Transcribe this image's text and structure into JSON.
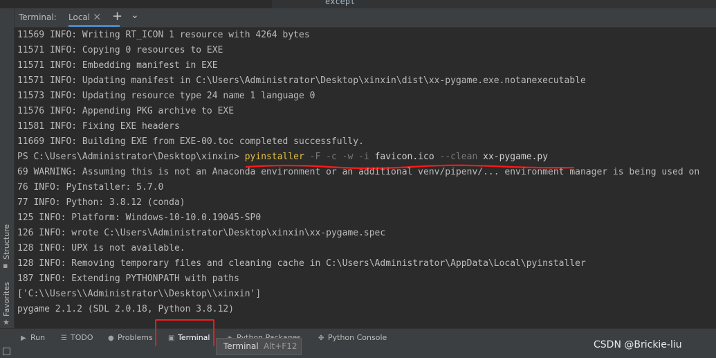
{
  "editor": {
    "fragment": "except"
  },
  "terminal": {
    "header_title": "Terminal:",
    "tab_label": "Local",
    "lines": [
      "11569 INFO: Writing RT_ICON 1 resource with 4264 bytes",
      "11571 INFO: Copying 0 resources to EXE",
      "11571 INFO: Embedding manifest in EXE",
      "11571 INFO: Updating manifest in C:\\Users\\Administrator\\Desktop\\xinxin\\dist\\xx-pygame.exe.notanexecutable",
      "11573 INFO: Updating resource type 24 name 1 language 0",
      "11576 INFO: Appending PKG archive to EXE",
      "11581 INFO: Fixing EXE headers",
      "11669 INFO: Building EXE from EXE-00.toc completed successfully."
    ],
    "prompt": {
      "path": "PS C:\\Users\\Administrator\\Desktop\\xinxin> ",
      "command": "pyinstaller",
      "flags1": " -F -c -w -i ",
      "icon_arg": "favicon.ico",
      "flags2": " --clean ",
      "script": "xx-pygame.py"
    },
    "output_lines": [
      "69 WARNING: Assuming this is not an Anaconda environment or an additional venv/pipenv/... environment manager is being used on",
      "76 INFO: PyInstaller: 5.7.0",
      "77 INFO: Python: 3.8.12 (conda)",
      "125 INFO: Platform: Windows-10-10.0.19045-SP0",
      "126 INFO: wrote C:\\Users\\Administrator\\Desktop\\xinxin\\xx-pygame.spec",
      "128 INFO: UPX is not available.",
      "128 INFO: Removing temporary files and cleaning cache in C:\\Users\\Administrator\\AppData\\Local\\pyinstaller",
      "187 INFO: Extending PYTHONPATH with paths",
      "['C:\\\\Users\\\\Administrator\\\\Desktop\\\\xinxin']",
      "pygame 2.1.2 (SDL 2.0.18, Python 3.8.12)"
    ]
  },
  "left_tabs": {
    "structure": "Structure",
    "favorites": "Favorites"
  },
  "bottom_tabs": {
    "run": "Run",
    "todo": "TODO",
    "problems": "Problems",
    "terminal": "Terminal",
    "python_packages": "Python Packages",
    "python_console": "Python Console"
  },
  "tooltip": {
    "label": "Terminal",
    "shortcut": "Alt+F12"
  },
  "watermark": "CSDN @Brickie-liu",
  "colors": {
    "annotation_red": "#ff1a1a",
    "active_tab_underline": "#4a88c7",
    "command_yellow": "#e0c046"
  }
}
